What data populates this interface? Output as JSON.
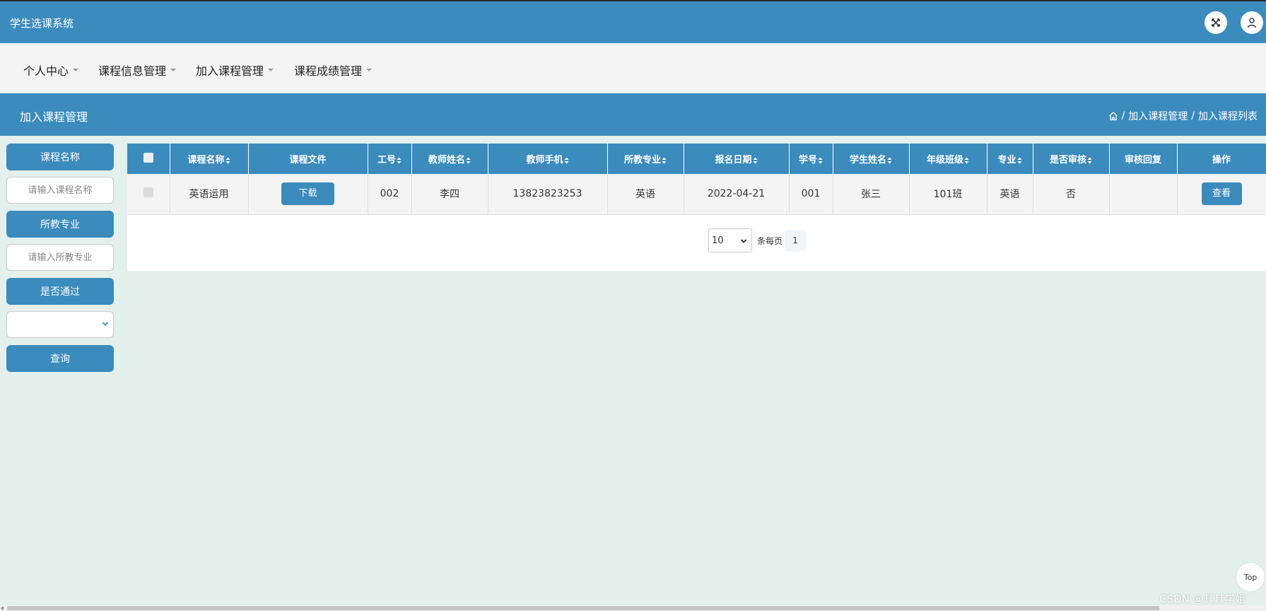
{
  "app": {
    "title": "学生选课系统"
  },
  "header": {
    "fullscreen_icon": "expand-arrows-icon",
    "user_icon": "user-icon"
  },
  "nav": {
    "items": [
      {
        "label": "个人中心"
      },
      {
        "label": "课程信息管理"
      },
      {
        "label": "加入课程管理"
      },
      {
        "label": "课程成绩管理"
      }
    ]
  },
  "section": {
    "title": "加入课程管理",
    "breadcrumb": {
      "sep": "/",
      "level1": "加入课程管理",
      "level2": "加入课程列表"
    }
  },
  "filters": {
    "course_name_label": "课程名称",
    "course_name_placeholder": "请输入课程名称",
    "major_label": "所教专业",
    "major_placeholder": "请输入所教专业",
    "passed_label": "是否通过",
    "passed_value": "",
    "query_button": "查询"
  },
  "table": {
    "columns": [
      "课程名称",
      "课程文件",
      "工号",
      "教师姓名",
      "教师手机",
      "所教专业",
      "报名日期",
      "学号",
      "学生姓名",
      "年级班级",
      "专业",
      "是否审核",
      "审核回复",
      "操作"
    ],
    "rows": [
      {
        "course_name": "英语运用",
        "file_button": "下载",
        "teacher_id": "002",
        "teacher_name": "李四",
        "teacher_phone": "13823823253",
        "teacher_major": "英语",
        "signup_date": "2022-04-21",
        "student_id": "001",
        "student_name": "张三",
        "grade_class": "101班",
        "major": "英语",
        "reviewed": "否",
        "review_reply": "",
        "view_button": "查看"
      }
    ]
  },
  "pagination": {
    "page_size": "10",
    "per_page_label": "条每页",
    "current_page": "1"
  },
  "misc": {
    "top_button": "Top",
    "watermark": "CSDN @其其学姐"
  },
  "colors": {
    "primary": "#3b8bbd",
    "background": "#e4f0ec",
    "nav_bg": "#f4f4f4"
  }
}
